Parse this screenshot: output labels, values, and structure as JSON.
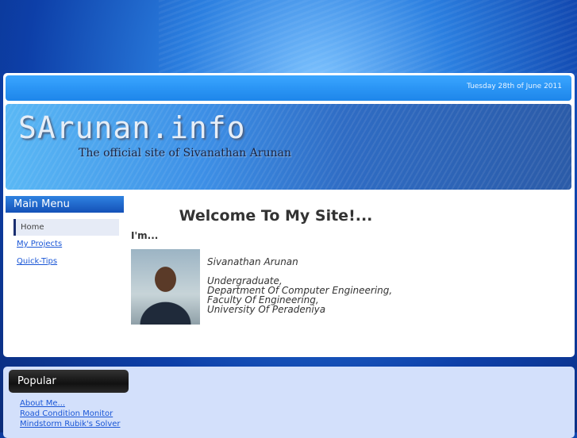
{
  "header": {
    "date": "Tuesday 28th of June 2011"
  },
  "banner": {
    "logo": "SArunan.info",
    "tagline": "The official site of Sivanathan Arunan"
  },
  "main_menu": {
    "title": "Main Menu",
    "items": [
      {
        "label": "Home"
      },
      {
        "label": "My Projects"
      },
      {
        "label": "Quick-Tips"
      }
    ]
  },
  "content": {
    "heading": "Welcome To My Site!...",
    "intro": "I'm...",
    "name": "Sivanathan Arunan",
    "lines": [
      "Undergraduate,",
      "Department Of Computer Engineering,",
      "Faculty Of Engineering,",
      "University Of Peradeniya"
    ]
  },
  "popular": {
    "title": "Popular",
    "items": [
      {
        "label": "About Me..."
      },
      {
        "label": "Road Condition Monitor"
      },
      {
        "label": "Mindstorm Rubik's Solver"
      }
    ]
  }
}
